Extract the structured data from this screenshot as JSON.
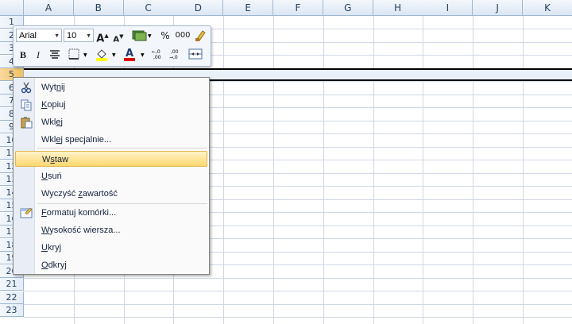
{
  "sheet": {
    "columns": [
      "A",
      "B",
      "C",
      "D",
      "E",
      "F",
      "G",
      "H",
      "I",
      "J",
      "K"
    ],
    "rows": [
      "1",
      "2",
      "3",
      "4",
      "5",
      "6",
      "7",
      "8",
      "9",
      "10",
      "11",
      "12",
      "13",
      "14",
      "15",
      "16",
      "17",
      "18",
      "19",
      "20",
      "21",
      "22",
      "23"
    ],
    "selected_row": "5"
  },
  "minibar": {
    "font_name": "Arial",
    "font_size": "10",
    "grow_font": "A",
    "shrink_font": "A",
    "percent": "%",
    "thousands": "000",
    "bold": "B",
    "italic": "I",
    "font_color_glyph": "A",
    "inc_decimal": ",0 ,00",
    "dec_decimal": ",00 ,0"
  },
  "context_menu": {
    "items": [
      {
        "pre": "Wyt",
        "ul": "n",
        "post": "ij",
        "icon": "scissors-icon"
      },
      {
        "pre": "",
        "ul": "K",
        "post": "opiuj",
        "icon": "copy-icon"
      },
      {
        "pre": "Wkl",
        "ul": "e",
        "post": "j",
        "icon": "paste-icon"
      },
      {
        "pre": "Wkl",
        "ul": "e",
        "post": "j specjalnie...",
        "icon": ""
      },
      {
        "pre": "W",
        "ul": "s",
        "post": "taw",
        "icon": ""
      },
      {
        "pre": "",
        "ul": "U",
        "post": "suń",
        "icon": ""
      },
      {
        "pre": "Wyczyść ",
        "ul": "z",
        "post": "awartość",
        "icon": ""
      },
      {
        "pre": "",
        "ul": "F",
        "post": "ormatuj komórki...",
        "icon": "format-cells-icon"
      },
      {
        "pre": "",
        "ul": "W",
        "post": "ysokość wiersza...",
        "icon": ""
      },
      {
        "pre": "",
        "ul": "U",
        "post": "kryj",
        "icon": ""
      },
      {
        "pre": "",
        "ul": "O",
        "post": "dkryj",
        "icon": ""
      }
    ]
  }
}
